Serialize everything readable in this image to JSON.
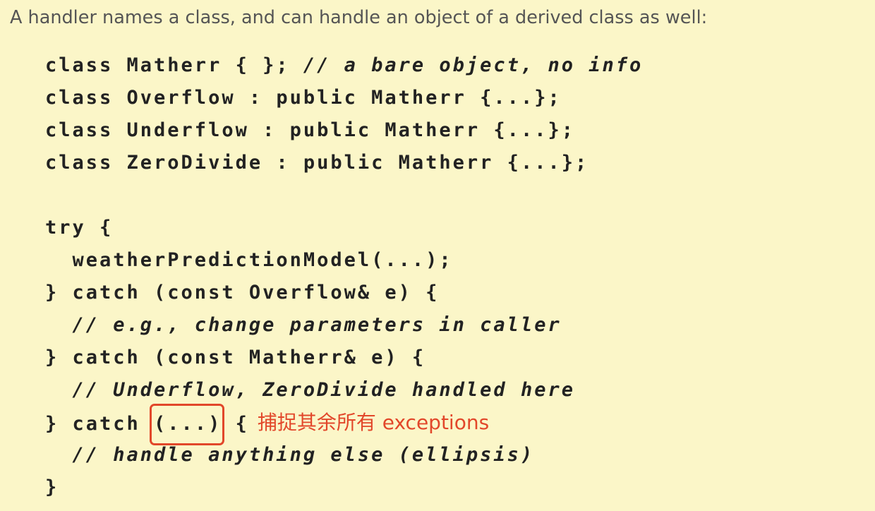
{
  "intro": "A handler names a class, and can handle an object of a derived class as well:",
  "code": {
    "l1": {
      "code": "class Matherr { }; ",
      "comment": "// a bare object, no info"
    },
    "l2": "class Overflow : public Matherr {...};",
    "l3": "class Underflow : public Matherr {...};",
    "l4": "class ZeroDivide : public Matherr {...};",
    "l6": "try {",
    "l7": "  weatherPredictionModel(...);",
    "l8": "} catch (const Overflow& e) {",
    "l9": "  // e.g., change parameters in caller",
    "l10": "} catch (const Matherr& e) {",
    "l11": "  // Underflow, ZeroDivide handled here",
    "l12": {
      "prefix": "} catch ",
      "boxed": "(...)",
      "suffix": " {"
    },
    "l13": "  // handle anything else (ellipsis)",
    "l14": "}"
  },
  "annotation": "捕捉其余所有 exceptions",
  "colors": {
    "background": "#fbf6c8",
    "text": "#222222",
    "intro": "#555555",
    "highlight": "#e2472a"
  }
}
